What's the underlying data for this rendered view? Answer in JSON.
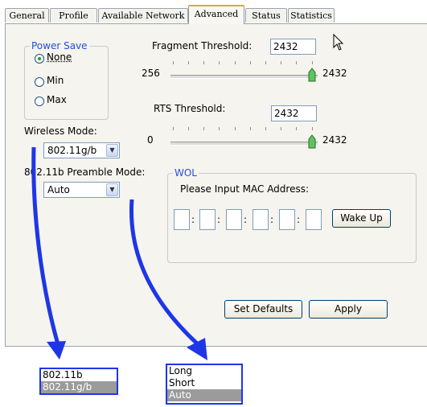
{
  "tabs": [
    {
      "label": "General"
    },
    {
      "label": "Profile"
    },
    {
      "label": "Available Network"
    },
    {
      "label": "Advanced"
    },
    {
      "label": "Status"
    },
    {
      "label": "Statistics"
    }
  ],
  "power_save": {
    "legend": "Power Save",
    "options": [
      {
        "label": "None",
        "selected": true
      },
      {
        "label": "Min",
        "selected": false
      },
      {
        "label": "Max",
        "selected": false
      }
    ]
  },
  "fragment": {
    "label": "Fragment Threshold:",
    "value": "2432",
    "min": "256",
    "max": "2432"
  },
  "rts": {
    "label": "RTS Threshold:",
    "value": "2432",
    "min": "0",
    "max": "2432"
  },
  "wireless_mode": {
    "label": "Wireless Mode:",
    "value": "802.11g/b",
    "options": [
      "802.11b",
      "802.11g/b"
    ]
  },
  "preamble": {
    "label": "802.11b Preamble Mode:",
    "value": "Auto",
    "options": [
      "Long",
      "Short",
      "Auto"
    ]
  },
  "wol": {
    "legend": "WOL",
    "prompt": "Please Input MAC Address:",
    "wake_label": "Wake Up",
    "separator": ":"
  },
  "buttons": {
    "set_defaults": "Set Defaults",
    "apply": "Apply"
  },
  "colors": {
    "accent": "#2450d8",
    "annotation": "#1f36e6",
    "active_tab_top": "#e8a33b"
  }
}
